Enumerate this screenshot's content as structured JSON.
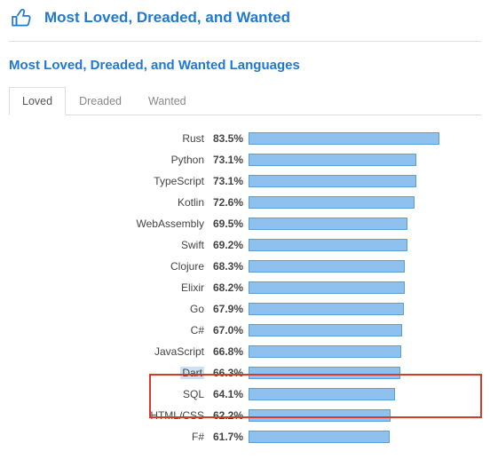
{
  "header": {
    "title": "Most Loved, Dreaded, and Wanted",
    "icon": "thumbs-up-icon"
  },
  "sub_title": "Most Loved, Dreaded, and Wanted Languages",
  "tabs": [
    {
      "label": "Loved",
      "active": true
    },
    {
      "label": "Dreaded",
      "active": false
    },
    {
      "label": "Wanted",
      "active": false
    }
  ],
  "chart_data": {
    "type": "bar",
    "orientation": "horizontal",
    "title": "Most Loved, Dreaded, and Wanted Languages — Loved",
    "xlabel": "",
    "ylabel": "",
    "xlim": [
      0,
      100
    ],
    "categories": [
      "Rust",
      "Python",
      "TypeScript",
      "Kotlin",
      "WebAssembly",
      "Swift",
      "Clojure",
      "Elixir",
      "Go",
      "C#",
      "JavaScript",
      "Dart",
      "SQL",
      "HTML/CSS",
      "F#"
    ],
    "values": [
      83.5,
      73.1,
      73.1,
      72.6,
      69.5,
      69.2,
      68.3,
      68.2,
      67.9,
      67.0,
      66.8,
      66.3,
      64.1,
      62.2,
      61.7
    ],
    "value_labels": [
      "83.5%",
      "73.1%",
      "73.1%",
      "72.6%",
      "69.5%",
      "69.2%",
      "68.3%",
      "68.2%",
      "67.9%",
      "67.0%",
      "66.8%",
      "66.3%",
      "64.1%",
      "62.2%",
      "61.7%"
    ],
    "bar_color": "#8fc1ef",
    "bar_border": "#5a9fd6",
    "highlight_rows": [
      "JavaScript",
      "Dart"
    ],
    "highlight_color": "#d43b2a"
  }
}
